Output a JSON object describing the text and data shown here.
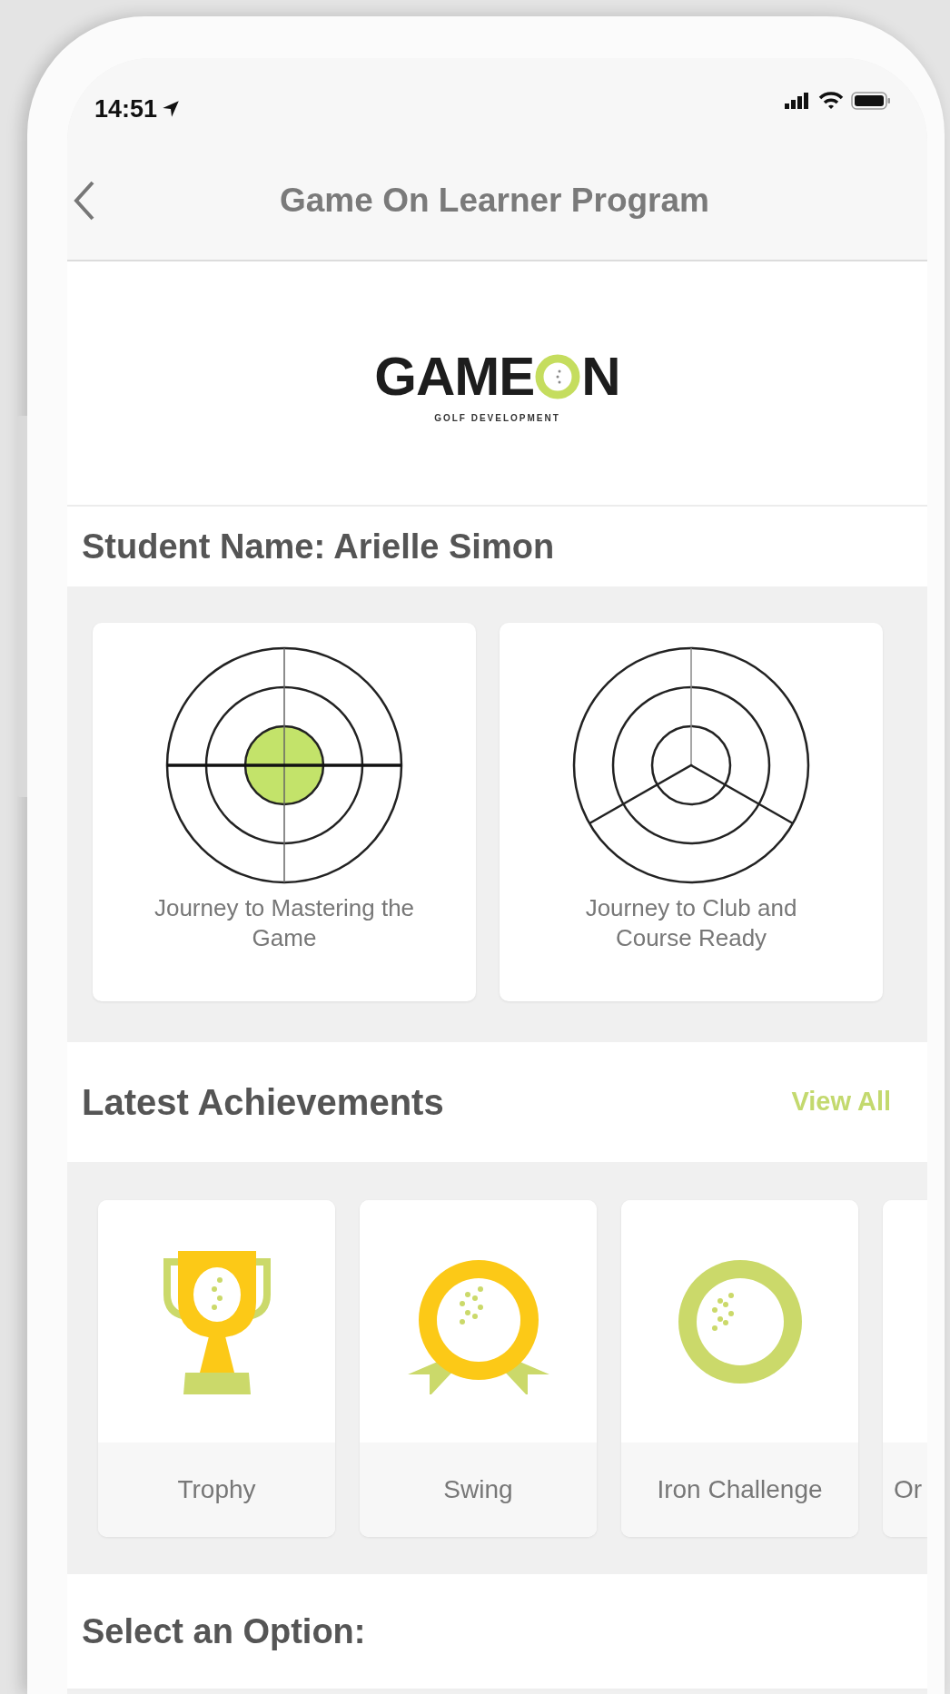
{
  "status_bar": {
    "time": "14:51"
  },
  "nav": {
    "title": "Game On Learner Program"
  },
  "logo": {
    "wordmark_left": "GAME",
    "wordmark_right": "N",
    "tagline": "GOLF DEVELOPMENT"
  },
  "student": {
    "label": "Student Name: Arielle Simon"
  },
  "journeys": [
    {
      "kind": "cross",
      "center_filled": true,
      "label": "Journey to Mastering the Game"
    },
    {
      "kind": "tri",
      "center_filled": false,
      "label": "Journey to Club and Course Ready"
    }
  ],
  "achievements_header": {
    "title": "Latest Achievements",
    "link": "View All"
  },
  "achievements": [
    {
      "kind": "trophy",
      "label": "Trophy"
    },
    {
      "kind": "medal",
      "label": "Swing"
    },
    {
      "kind": "ring",
      "label": "Iron Challenge"
    },
    {
      "label": "Or"
    }
  ],
  "options_header": {
    "title": "Select an Option:"
  }
}
